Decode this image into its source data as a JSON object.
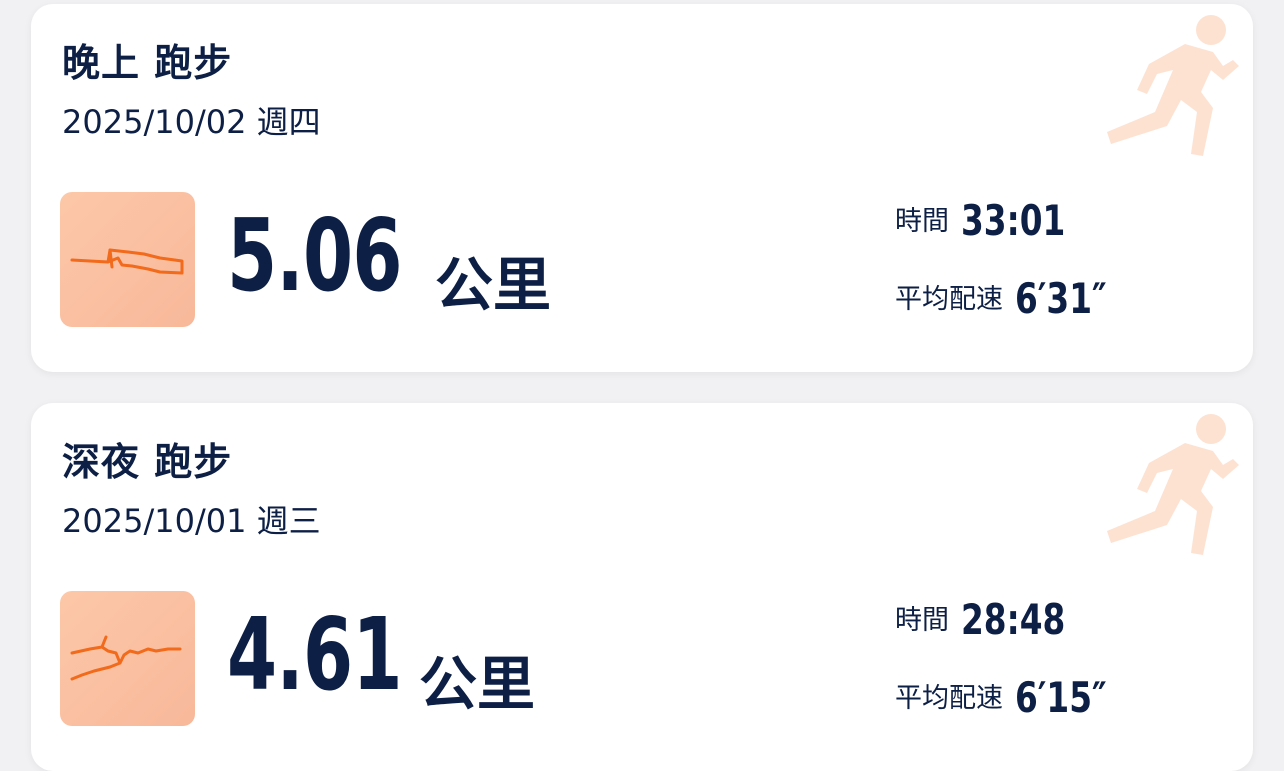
{
  "activities": [
    {
      "title": "晚上 跑步",
      "date": "2025/10/02 週四",
      "distance": "5.06",
      "distance_unit": "公里",
      "time_label": "時間",
      "time_value": "33:01",
      "pace_label": "平均配速",
      "pace_value": "6′31″",
      "activity_icon": "running-person-icon",
      "route_icon": "route-map-thumbnail"
    },
    {
      "title": "深夜 跑步",
      "date": "2025/10/01 週三",
      "distance": "4.61",
      "distance_unit": "公里",
      "time_label": "時間",
      "time_value": "28:48",
      "pace_label": "平均配速",
      "pace_value": "6′15″",
      "activity_icon": "running-person-icon",
      "route_icon": "route-map-thumbnail"
    }
  ],
  "colors": {
    "text": "#0d1f45",
    "accent": "#f26a1b",
    "thumb_bg": "#fcc8a8",
    "runner_icon": "#fde4d6",
    "card_bg": "#ffffff",
    "page_bg": "#f1f1f3"
  }
}
